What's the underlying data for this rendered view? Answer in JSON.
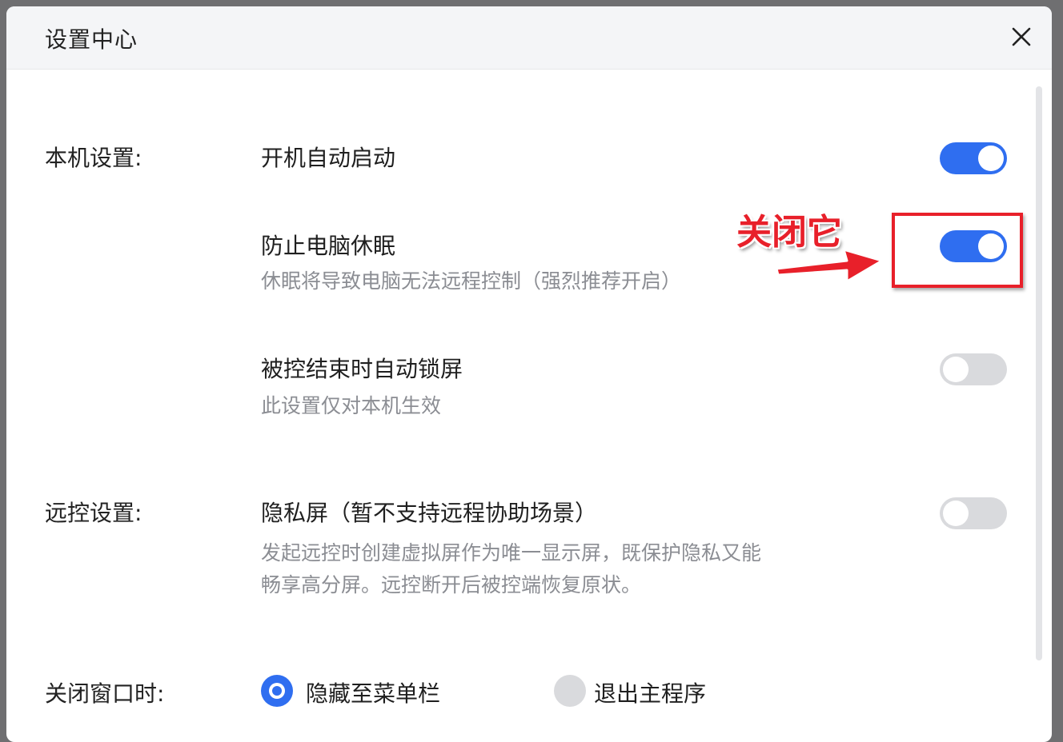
{
  "dialog": {
    "title": "设置中心"
  },
  "sections": {
    "local_label": "本机设置:",
    "remote_label": "远控设置:",
    "close_label": "关闭窗口时:"
  },
  "items": {
    "autostart": {
      "title": "开机自动启动",
      "enabled": true
    },
    "prevent_sleep": {
      "title": "防止电脑休眠",
      "desc": "休眠将导致电脑无法远程控制（强烈推荐开启）",
      "enabled": true
    },
    "auto_lock": {
      "title": "被控结束时自动锁屏",
      "desc": "此设置仅对本机生效",
      "enabled": false
    },
    "privacy_screen": {
      "title": "隐私屏（暂不支持远程协助场景）",
      "desc_line1": "发起远控时创建虚拟屏作为唯一显示屏，既保护隐私又能",
      "desc_line2": "畅享高分屏。远控断开后被控端恢复原状。",
      "enabled": false
    }
  },
  "close_behavior": {
    "options": [
      {
        "label": "隐藏至菜单栏",
        "checked": true
      },
      {
        "label": "退出主程序",
        "checked": false
      }
    ]
  },
  "annotation": {
    "text": "关闭它",
    "color": "#e8202a"
  },
  "colors": {
    "accent": "#2f6ef0",
    "toggle_off": "#d9dadd",
    "desc_text": "#8b8d93"
  },
  "icons": {
    "close": "close-icon"
  }
}
